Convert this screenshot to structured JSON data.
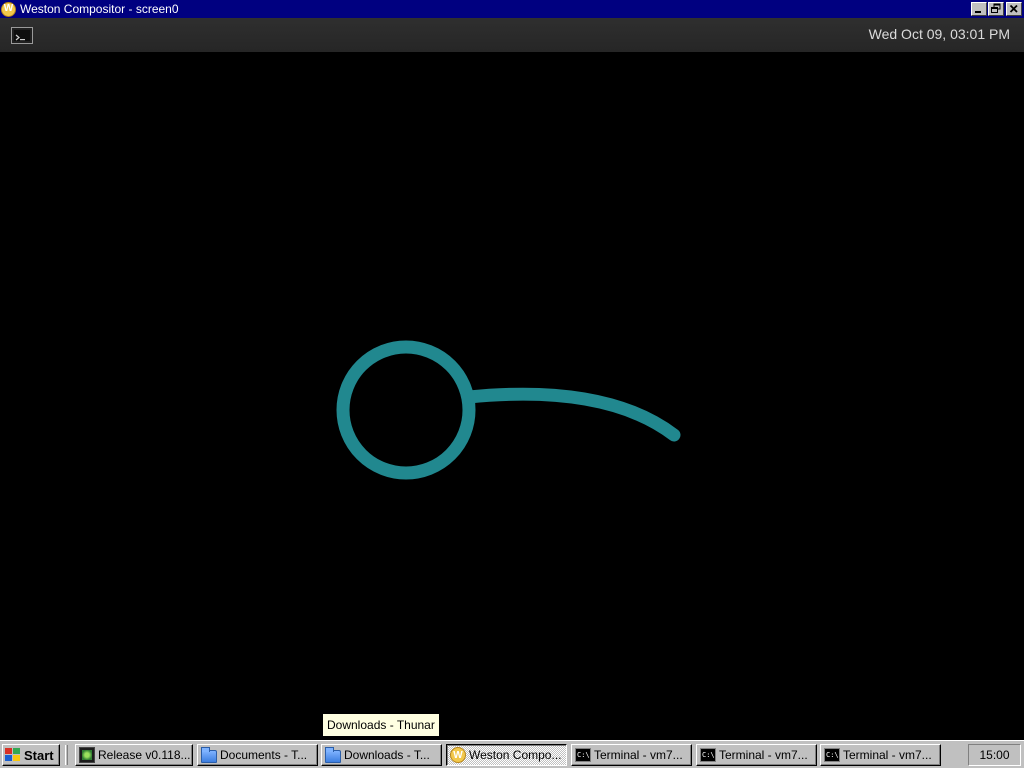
{
  "window": {
    "title": "Weston Compositor - screen0",
    "icon": "weston-icon",
    "controls": [
      "minimize",
      "restore",
      "close"
    ]
  },
  "weston_panel": {
    "launcher_icon": "terminal-icon",
    "clock": "Wed Oct 09, 03:01 PM"
  },
  "canvas": {
    "drawing": "teal stroke - circle with tail",
    "stroke_color": "#21888f",
    "background": "#000000"
  },
  "tooltip": {
    "text": "Downloads - Thunar"
  },
  "taskbar": {
    "start_label": "Start",
    "tasks": [
      {
        "label": "Release v0.118...",
        "icon": "release-icon",
        "active": false
      },
      {
        "label": "Documents - T...",
        "icon": "folder-icon",
        "active": false
      },
      {
        "label": "Downloads - T...",
        "icon": "folder-icon",
        "active": false
      },
      {
        "label": "Weston Compo...",
        "icon": "weston-icon",
        "active": true
      },
      {
        "label": "Terminal - vm7...",
        "icon": "terminal-icon",
        "active": false
      },
      {
        "label": "Terminal - vm7...",
        "icon": "terminal-icon",
        "active": false
      },
      {
        "label": "Terminal - vm7...",
        "icon": "terminal-icon",
        "active": false
      }
    ],
    "tray_time": "15:00"
  },
  "colors": {
    "title_bar": "#000080",
    "panel": "#2b2b2b",
    "taskbar": "#c0c0c0",
    "tooltip_bg": "#ffffe1"
  }
}
